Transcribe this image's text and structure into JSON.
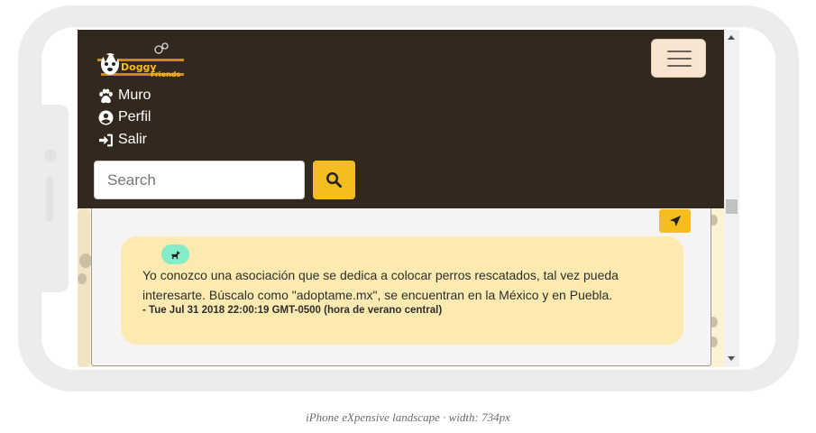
{
  "app": {
    "brand_text_1": "Doggy",
    "brand_text_2": "Friends"
  },
  "nav": {
    "items": [
      {
        "label": "Muro",
        "icon": "paw-icon"
      },
      {
        "label": "Perfil",
        "icon": "user-circle-icon"
      },
      {
        "label": "Salir",
        "icon": "sign-in-icon"
      }
    ]
  },
  "search": {
    "placeholder": "Search"
  },
  "comment": {
    "text": "Yo conozco una asociación que se dedica a colocar perros rescatados, tal vez pueda interesarte. Búscalo como \"adoptame.mx\", se encuentran en la México y en Puebla.",
    "date": "- Tue Jul 31 2018 22:00:19 GMT-0500 (hora de verano central)"
  },
  "caption": "iPhone eXpensive landscape · width: 734px",
  "colors": {
    "navbar": "#33281e",
    "accent": "#f6bd1f",
    "comment_bg": "#fdeab0",
    "avatar_bg": "#84ecc9",
    "page_bg": "#fbf2d6"
  }
}
